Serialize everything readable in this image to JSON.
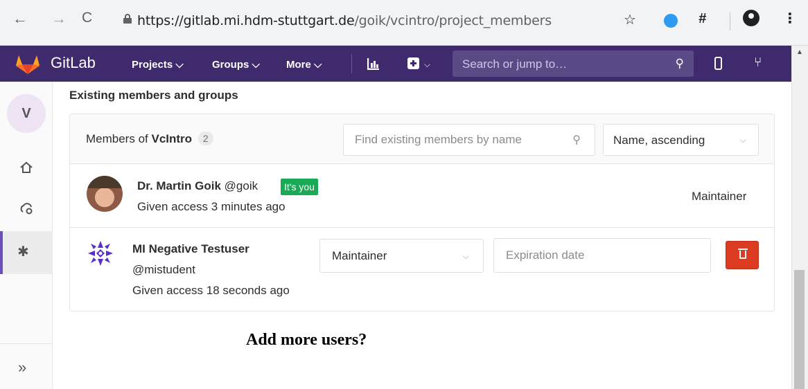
{
  "browser": {
    "url_host": "https://gitlab.mi.hdm-stuttgart.de",
    "url_path": "/goik/vcintro/project_members",
    "icons": [
      "back-icon",
      "forward-icon",
      "reload-icon",
      "lock-icon",
      "star-icon",
      "extension-icon",
      "hash-icon",
      "profile-icon",
      "menu-icon"
    ],
    "hash_ext": "#"
  },
  "gitlab_nav": {
    "brand": "GitLab",
    "projects": "Projects ⌵",
    "groups": "Groups ⌵",
    "more": "More ⌵",
    "search_placeholder": "Search or jump to…",
    "brand_color": "#3e2a6d"
  },
  "sidebar": {
    "project_avatar": "V",
    "items": [
      "home-icon",
      "cloud-gear-icon",
      "settings-icon"
    ],
    "collapse": "»"
  },
  "members": {
    "section_title": "Existing members and groups",
    "members_of_prefix": "Members of",
    "project_name": "VcIntro",
    "count": "2",
    "find_placeholder": "Find existing members by name",
    "sort_value": "Name, ascending",
    "rows": [
      {
        "name": "Dr. Martin Goik",
        "handle": "@goik",
        "badge": "It's you",
        "given": "Given access 3 minutes ago",
        "role": "Maintainer"
      },
      {
        "name": "MI Negative Testuser",
        "handle": "@mistudent",
        "given": "Given access 18 seconds ago",
        "role": "Maintainer",
        "expiration_placeholder": "Expiration date"
      }
    ]
  },
  "caption": "Add more users?"
}
